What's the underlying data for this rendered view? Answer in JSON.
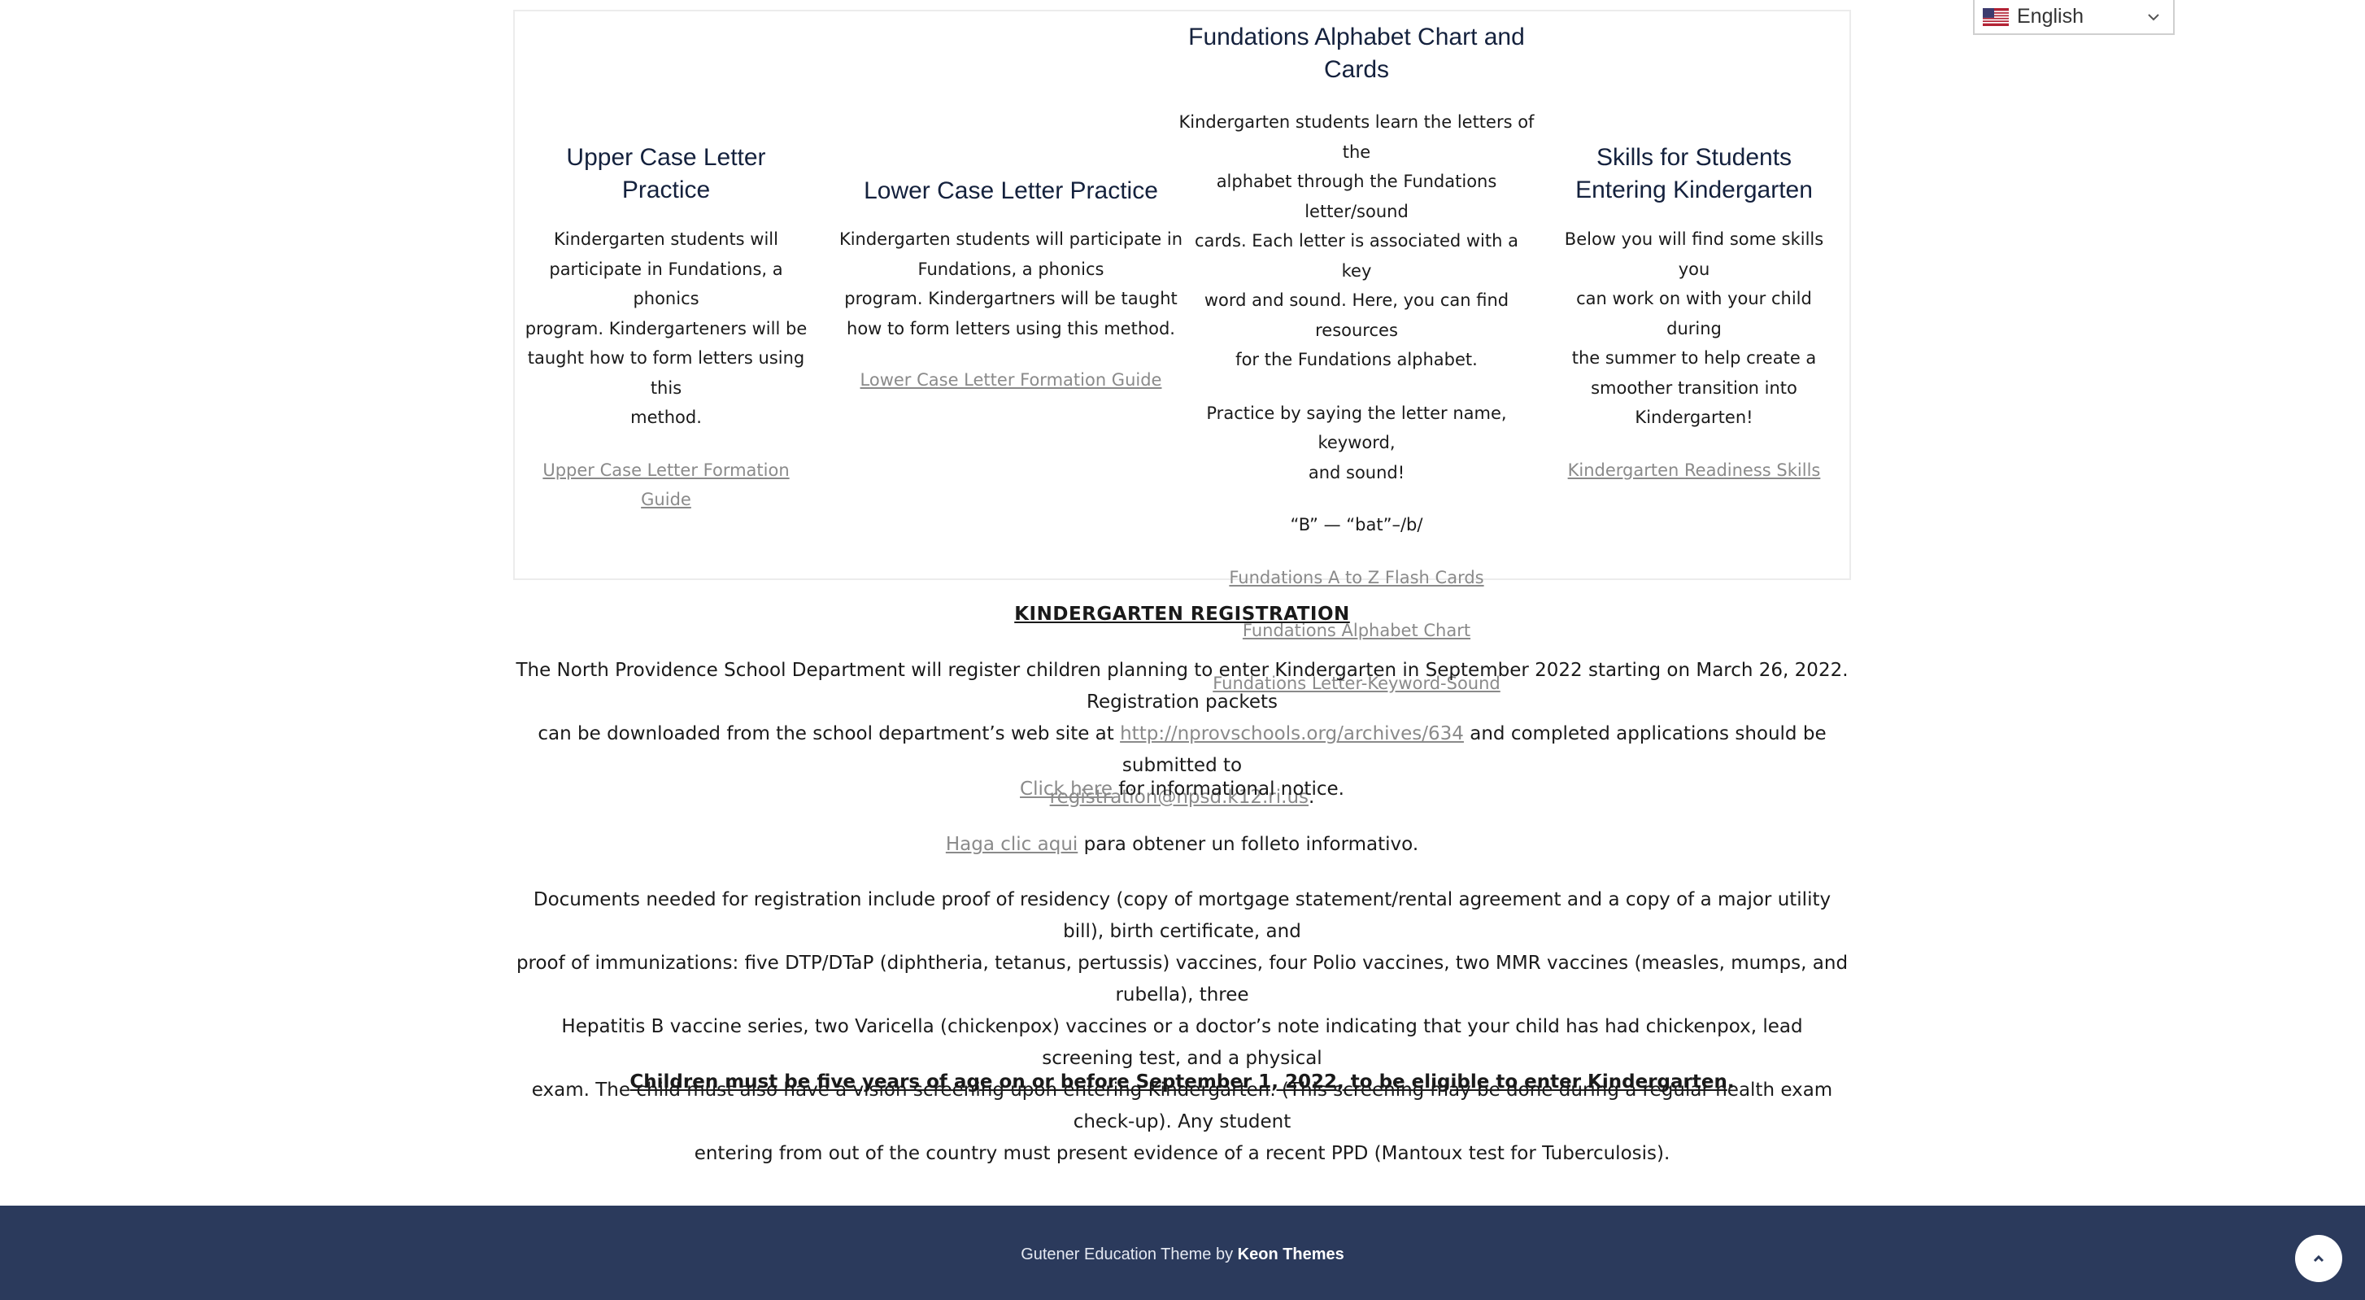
{
  "language": {
    "selected": "English",
    "flag_icon": "us-flag-icon",
    "chevron_icon": "chevron-down-icon"
  },
  "columns": [
    {
      "title_line1": "Upper Case Letter",
      "title_line2": "Practice",
      "body_lines": [
        "Kindergarten students will",
        "participate in Fundations, a phonics",
        "program. Kindergarteners will be",
        "taught how to form letters using this",
        "method."
      ],
      "links": [
        "Upper Case Letter Formation Guide"
      ]
    },
    {
      "title_line1": "Lower Case Letter Practice",
      "body_lines": [
        "Kindergarten students will participate in",
        "Fundations, a phonics",
        "program.  Kindergartners will be taught",
        "how to form letters using this method."
      ],
      "links": [
        "Lower Case Letter Formation Guide"
      ]
    },
    {
      "title_line1": "Fundations Alphabet Chart and",
      "title_line2": "Cards",
      "body_lines": [
        "Kindergarten students learn the letters of the",
        "alphabet through the Fundations letter/sound",
        "cards.  Each letter is associated with a key",
        "word and sound. Here, you can find resources",
        "for the Fundations alphabet."
      ],
      "practice_lines": [
        "Practice by saying the letter name, keyword,",
        "and sound!"
      ],
      "example": "“B” — “bat”–/b/",
      "links": [
        "Fundations A to Z Flash Cards",
        "Fundations Alphabet Chart",
        "Fundations Letter-Keyword-Sound"
      ]
    },
    {
      "title_line1": "Skills for Students",
      "title_line2": "Entering Kindergarten",
      "body_lines": [
        "Below you will find some skills you",
        "can work on with your child during",
        "the summer to help create a",
        "smoother transition into",
        "Kindergarten!"
      ],
      "links": [
        "Kindergarten Readiness Skills"
      ]
    }
  ],
  "registration": {
    "title": "KINDERGARTEN REGISTRATION",
    "intro_line1": "The North Providence School Department will register children planning to enter Kindergarten in September 2022 starting on March 26, 2022.  Registration packets",
    "intro_line2_a": "can be downloaded from the school department’s web site at ",
    "intro_link_url": "http://nprovschools.org/archives/634",
    "intro_line2_b": " and completed applications should be submitted to",
    "intro_email": "registration@npsd.k12.ri.us",
    "intro_end": ".",
    "notice_link": "Click here",
    "notice_text": " for informational notice.",
    "es_link": "Haga clic aqui",
    "es_text": " para obtener un folleto informativo.",
    "documents_lines": [
      "Documents needed for registration include proof of residency (copy of mortgage statement/rental agreement and a copy of a major utility bill), birth certificate, and",
      "proof of immunizations: five DTP/DTaP (diphtheria, tetanus, pertussis) vaccines, four Polio vaccines, two MMR vaccines (measles, mumps, and rubella), three",
      "Hepatitis B vaccine series, two Varicella (chickenpox) vaccines or a doctor’s note indicating that your child has had chickenpox, lead screening test, and a physical",
      "exam.  The child must also have a vision screening upon entering Kindergarten. (This screening may be done during a regular health exam check-up).  Any student",
      "entering from out of the country must present evidence of a recent PPD (Mantoux test for Tuberculosis)."
    ],
    "age_rule": "Children must be five years of age on or before September 1, 2022, to be eligible to enter Kindergarten",
    "age_rule_end": "."
  },
  "footer": {
    "text": "Gutener Education Theme by ",
    "brand": "Keon Themes",
    "to_top_icon": "chevron-up-icon"
  },
  "colors": {
    "footer_bg": "#2b3a5c",
    "heading": "#14213d",
    "link": "#8a8a8a"
  }
}
